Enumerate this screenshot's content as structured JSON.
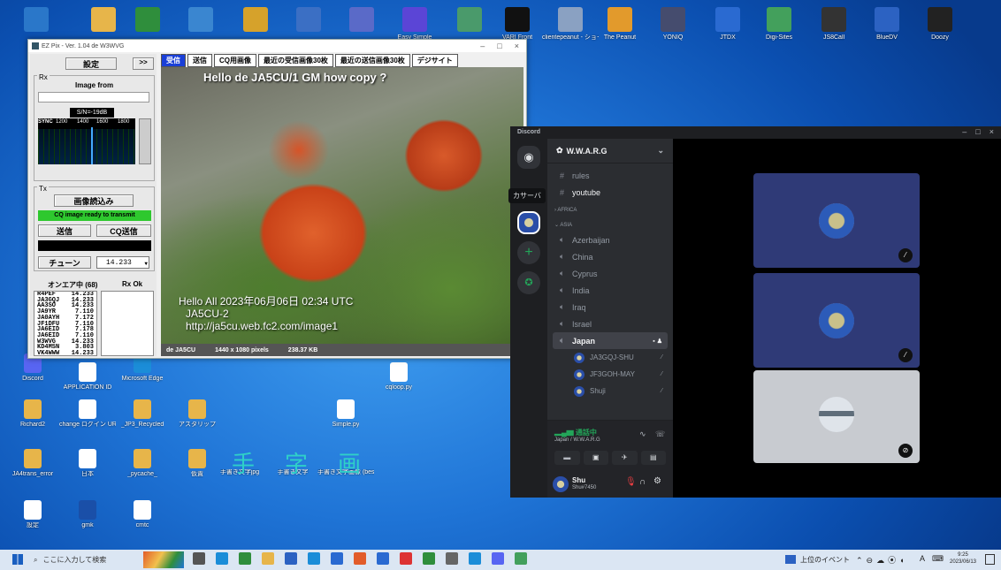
{
  "desktop": {
    "top_icons": [
      {
        "label": "",
        "color": "#2a77c9"
      },
      {
        "label": "",
        "color": "#e7b54a"
      },
      {
        "label": "",
        "color": "#2f8e3c"
      },
      {
        "label": "",
        "color": "#3a86d0"
      },
      {
        "label": "",
        "color": "#d6a22b"
      },
      {
        "label": "",
        "color": "#3b6fc4"
      },
      {
        "label": "",
        "color": "#5a6ac8"
      },
      {
        "label": "Easy Simple",
        "color": "#5b45d6"
      },
      {
        "label": "",
        "color": "#4a9a6b"
      },
      {
        "label": "VARI Front",
        "color": "#111111"
      },
      {
        "label": "clientepeanut - ショートカット",
        "color": "#8aa1c2"
      },
      {
        "label": "The Peanut",
        "color": "#e29a2c"
      },
      {
        "label": "YONIQ",
        "color": "#454c6e"
      },
      {
        "label": "JTDX",
        "color": "#2a6ad1"
      },
      {
        "label": "Digi-Sites",
        "color": "#43a05c"
      },
      {
        "label": "JS8Call",
        "color": "#333333"
      },
      {
        "label": "BlueDV",
        "color": "#2c62c2"
      },
      {
        "label": "Doozy",
        "color": "#222222"
      }
    ],
    "left_icons": [
      {
        "label": "Discord",
        "color": "#5865f2"
      },
      {
        "label": "APPLICATION ID",
        "color": "#ffffff"
      },
      {
        "label": "Microsoft Edge",
        "color": "#1b8dd8"
      },
      {
        "label": "cqloop.py",
        "color": "#ffffff"
      },
      {
        "label": "Richard2",
        "color": "#e7b54a"
      },
      {
        "label": "change ログイン URL",
        "color": "#ffffff"
      },
      {
        "label": "_JP3_Recycled",
        "color": "#e7b54a"
      },
      {
        "label": "アスタリップ",
        "color": "#e7b54a"
      },
      {
        "label": "Simple.py",
        "color": "#ffffff"
      },
      {
        "label": "JA4trans_error",
        "color": "#e7b54a"
      },
      {
        "label": "日本",
        "color": "#ffffff"
      },
      {
        "label": "_pycache_",
        "color": "#e7b54a"
      },
      {
        "label": "仮置",
        "color": "#e7b54a"
      },
      {
        "label": "手書き文字jpg",
        "color": "#00000000"
      },
      {
        "label": "手書き文字",
        "color": "#00000000"
      },
      {
        "label": "手書き文字画像 (best-DESKTOP...",
        "color": "#00000000"
      },
      {
        "label": "設定",
        "color": "#ffffff"
      },
      {
        "label": "gmk",
        "color": "#1a4fa8"
      },
      {
        "label": "cmtc",
        "color": "#ffffff"
      }
    ],
    "big_chars": [
      "手",
      "字",
      "画"
    ]
  },
  "ezpix": {
    "title": "EZ Pix - Ver. 1.04 de W3WVG",
    "settings_btn": "設定",
    "arrow_btn": ">>",
    "tabs": [
      "受信",
      "送信",
      "CQ用画像",
      "最近の受信画像30枚",
      "最近の送信画像30枚",
      "デジサイト"
    ],
    "rx_label": "Rx",
    "image_from": "Image from",
    "sn": "S/N=-19dB",
    "sync": "SYNC",
    "scale": [
      "1200",
      "1400",
      "1600",
      "1800"
    ],
    "tx_label": "Tx",
    "load_btn": "画像読込み",
    "status": "CQ image ready to transmit",
    "send_btn": "送信",
    "cq_send_btn": "CQ送信",
    "tune_btn": "チューン",
    "freq": "14.233",
    "onair_header": "オンエア中 (68)",
    "rxok_header": "Rx Ok",
    "stations": [
      {
        "call": "R4PEF",
        "freq": "14.233"
      },
      {
        "call": "JA3GQJ",
        "freq": "14.233"
      },
      {
        "call": "AA3SO",
        "freq": "14.233"
      },
      {
        "call": "JA9YR",
        "freq": "7.110"
      },
      {
        "call": "JA0AYH",
        "freq": "7.172"
      },
      {
        "call": "JF1DFU",
        "freq": "7.110"
      },
      {
        "call": "JA6EID",
        "freq": "7.178"
      },
      {
        "call": "JA6EID",
        "freq": "7.110"
      },
      {
        "call": "W3WVG",
        "freq": "14.233"
      },
      {
        "call": "KD4MSN",
        "freq": "3.803"
      },
      {
        "call": "VK4WWW",
        "freq": "14.233"
      }
    ],
    "image_top_text": "Hello de JA5CU/1 GM how copy ?",
    "image_bottom_line1": "Hello All 2023年06月06日 02:34 UTC",
    "image_bottom_line2": "JA5CU-2",
    "image_bottom_line3": "http://ja5cu.web.fc2.com/image1",
    "status_from": "de JA5CU",
    "status_dims": "1440 x 1080 pixels",
    "status_size": "238.37 KB"
  },
  "discord": {
    "app_name": "Discord",
    "server_name": "W.W.A.R.G",
    "tooltip": "カサーバ",
    "channels": [
      "rules",
      "youtube"
    ],
    "cat_africa": "AFRICA",
    "cat_asia": "ASIA",
    "voice": [
      "Azerbaijan",
      "China",
      "Cyprus",
      "India",
      "Iraq",
      "Israel",
      "Japan"
    ],
    "members": [
      "JA3GQJ-SHU",
      "JF3GOH-MAY",
      "Shuji"
    ],
    "connected": "通話中",
    "connected_sub": "Japan / W.W.A.R.G",
    "user": "Shu",
    "user_tag": "Shu#7450"
  },
  "taskbar": {
    "search": "ここに入力して検索",
    "news": "上位のイベント",
    "ime": "A",
    "time": "9:25",
    "date": "2023/06/13"
  },
  "colors": {
    "discord_bg": "#1e1f22",
    "discord_sidebar": "#2b2d31",
    "tile": "#2f3a77",
    "ez_blue": "#1a3fd8",
    "status_green": "#2ec82e"
  }
}
